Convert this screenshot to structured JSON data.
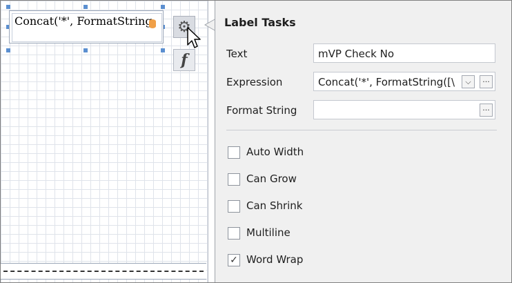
{
  "design_surface": {
    "label_text": "Concat('*', FormatString",
    "smart_tag_icon": "gear-icon",
    "expression_button_icon": "function-icon",
    "expression_button_glyph": "f"
  },
  "panel": {
    "title": "Label Tasks",
    "properties": {
      "text": {
        "label": "Text",
        "value": "mVP Check No"
      },
      "expression": {
        "label": "Expression",
        "value": "Concat('*', FormatString([\\",
        "dropdown_glyph": "⌵",
        "ellipsis_glyph": "···"
      },
      "format_string": {
        "label": "Format String",
        "value": "",
        "ellipsis_glyph": "···"
      }
    },
    "options": [
      {
        "label": "Auto Width",
        "checked": false
      },
      {
        "label": "Can Grow",
        "checked": false
      },
      {
        "label": "Can Shrink",
        "checked": false
      },
      {
        "label": "Multiline",
        "checked": false
      },
      {
        "label": "Word Wrap",
        "checked": true
      }
    ]
  },
  "colors": {
    "panel_bg": "#f0f0f0",
    "grid_line": "#dfe3ea",
    "selection_handle": "#5b8fd0",
    "datasource_marker": "#f0a048"
  }
}
